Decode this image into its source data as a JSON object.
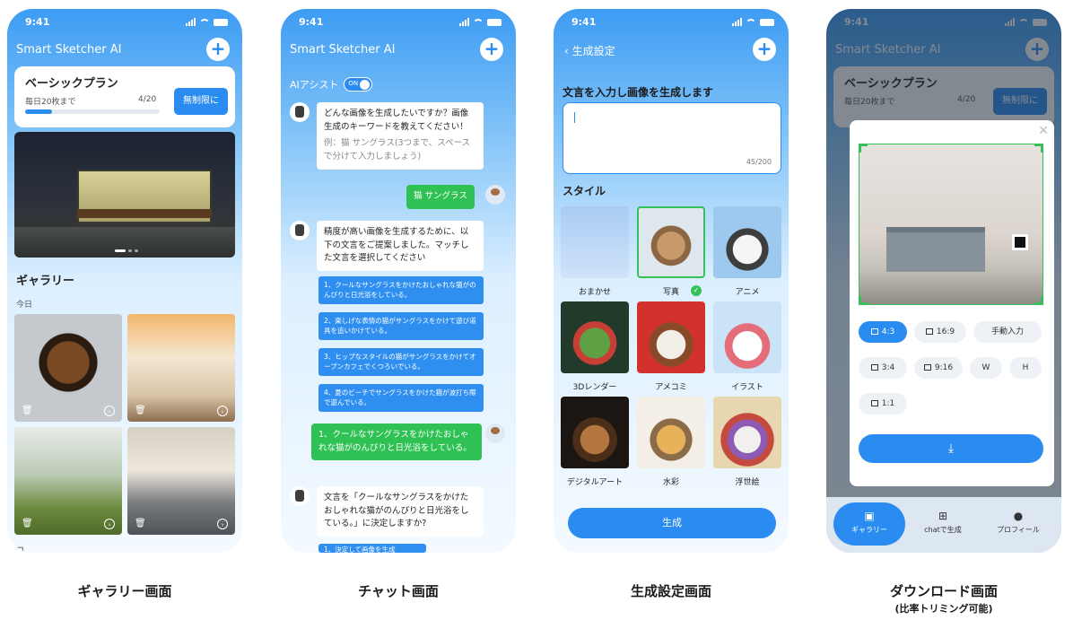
{
  "status_time": "9:41",
  "app_title": "Smart Sketcher AI",
  "gallery": {
    "plan_title": "ベーシックプラン",
    "plan_sub": "毎日20枚まで",
    "plan_count": "4/20",
    "plan_progress": 0.2,
    "unlimited_label": "無制限に",
    "section_title": "ギャラリー",
    "date_label": "今日",
    "next_section_peek": "コ"
  },
  "chat": {
    "ai_assist_label": "AIアシスト",
    "toggle_label": "ON",
    "bot_msg1": "どんな画像を生成したいですか？画像生成のキーワードを教えてください！",
    "bot_msg1_hint": "例：猫 サングラス(3つまで、スペースで分けて入力しましょう)",
    "user_msg1": "猫 サングラス",
    "bot_msg2": "精度が高い画像を生成するために、以下の文言をご提案しました。マッチした文言を選択してください",
    "options": [
      "1、クールなサングラスをかけたおしゃれな猫がのんびりと日光浴をしている。",
      "2、楽しげな表情の猫がサングラスをかけて遊び道具を追いかけている。",
      "3、ヒップなスタイルの猫がサングラスをかけてオープンカフェでくつろいでいる。",
      "4、夏のビーチでサングラスをかけた猫が波打ち際で遊んでいる。"
    ],
    "user_msg2": "1、クールなサングラスをかけたおしゃれな猫がのんびりと日光浴をしている。",
    "bot_msg3": "文言を「クールなサングラスをかけたおしゃれな猫がのんびりと日光浴をしている。」に決定しますか?",
    "peek_option": "1、決定して画像を生成"
  },
  "settings": {
    "title": "生成設定",
    "prompt_title": "文言を入力し画像を生成します",
    "char_count": "45/200",
    "style_title": "スタイル",
    "styles": [
      "おまかせ",
      "写真",
      "アニメ",
      "3Dレンダー",
      "アメコミ",
      "イラスト",
      "デジタルアート",
      "水彩",
      "浮世絵"
    ],
    "generate_label": "生成"
  },
  "download": {
    "ratios": [
      "4:3",
      "16:9",
      "手動入力",
      "3:4",
      "9:16",
      "W",
      "H",
      "1:1"
    ],
    "tabs": [
      "ギャラリー",
      "chatで生成",
      "プロフィール"
    ]
  },
  "captions": {
    "gallery": "ギャラリー画面",
    "chat": "チャット画面",
    "settings": "生成設定画面",
    "download": "ダウンロード画面",
    "download_sub": "(比率トリミング可能)"
  },
  "colors": {
    "accent": "#2a8cf0",
    "green": "#2fc153"
  }
}
